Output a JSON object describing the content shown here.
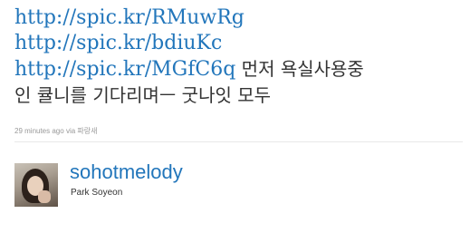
{
  "tweet": {
    "links": [
      "http://spic.kr/RMuwRg",
      "http://spic.kr/bdiuKc",
      "http://spic.kr/MGfC6q"
    ],
    "text_after_link": " 먼저 욕실사용중",
    "text_line2": "인 큘니를 기다리며ㅡ 굿나잇 모두",
    "timestamp": "29 minutes ago",
    "via_label": "via",
    "source": "파랑새"
  },
  "author": {
    "avatar_icon": "profile-photo",
    "screen_name": "sohotmelody",
    "full_name": "Park Soyeon"
  },
  "colors": {
    "link": "#2276bb",
    "text": "#333333",
    "meta": "#999999"
  }
}
